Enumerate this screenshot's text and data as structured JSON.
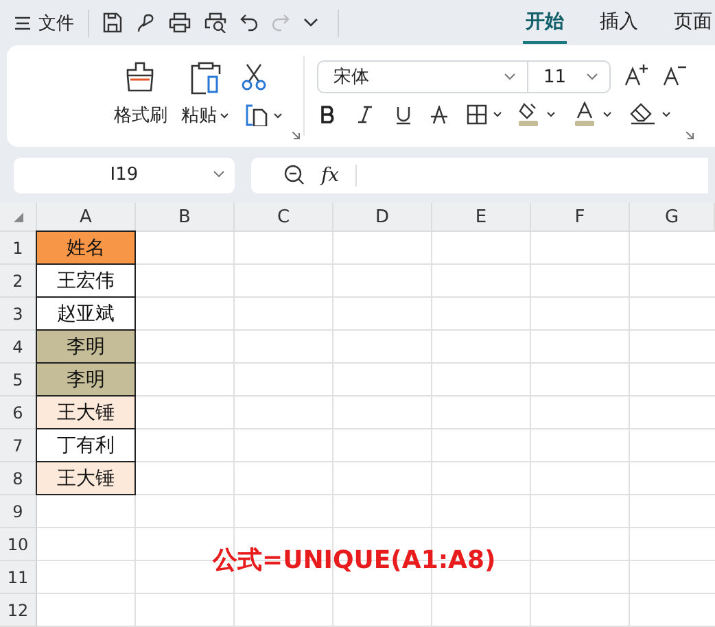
{
  "menu": {
    "label": "文件"
  },
  "tabs": [
    {
      "label": "开始",
      "selected": true
    },
    {
      "label": "插入",
      "selected": false
    },
    {
      "label": "页面",
      "selected": false
    }
  ],
  "ribbon": {
    "format_painter": "格式刷",
    "paste": "粘贴",
    "font": "宋体",
    "size": "11"
  },
  "name_box": "I19",
  "formula_bar": {
    "fx": "fx"
  },
  "grid": {
    "columns": [
      "A",
      "B",
      "C",
      "D",
      "E",
      "F",
      "G"
    ],
    "rows": [
      {
        "number": "1",
        "name": {
          "text": "姓名",
          "color": "#f79646"
        }
      },
      {
        "number": "2",
        "name": {
          "text": "王宏伟",
          "color": "#ffffff"
        }
      },
      {
        "number": "3",
        "name": {
          "text": "赵亚斌",
          "color": "#ffffff"
        }
      },
      {
        "number": "4",
        "name": {
          "text": "李明",
          "color": "#c4bd97"
        }
      },
      {
        "number": "5",
        "name": {
          "text": "李明",
          "color": "#c4bd97"
        }
      },
      {
        "number": "6",
        "name": {
          "text": "王大锤",
          "color": "#fce9da"
        }
      },
      {
        "number": "7",
        "name": {
          "text": "丁有利",
          "color": "#ffffff"
        }
      },
      {
        "number": "8",
        "name": {
          "text": "王大锤",
          "color": "#fce9da"
        }
      },
      {
        "number": "9"
      },
      {
        "number": "10"
      },
      {
        "number": "11"
      },
      {
        "number": "12"
      }
    ]
  },
  "annotation": "公式=UNIQUE(A1:A8)"
}
